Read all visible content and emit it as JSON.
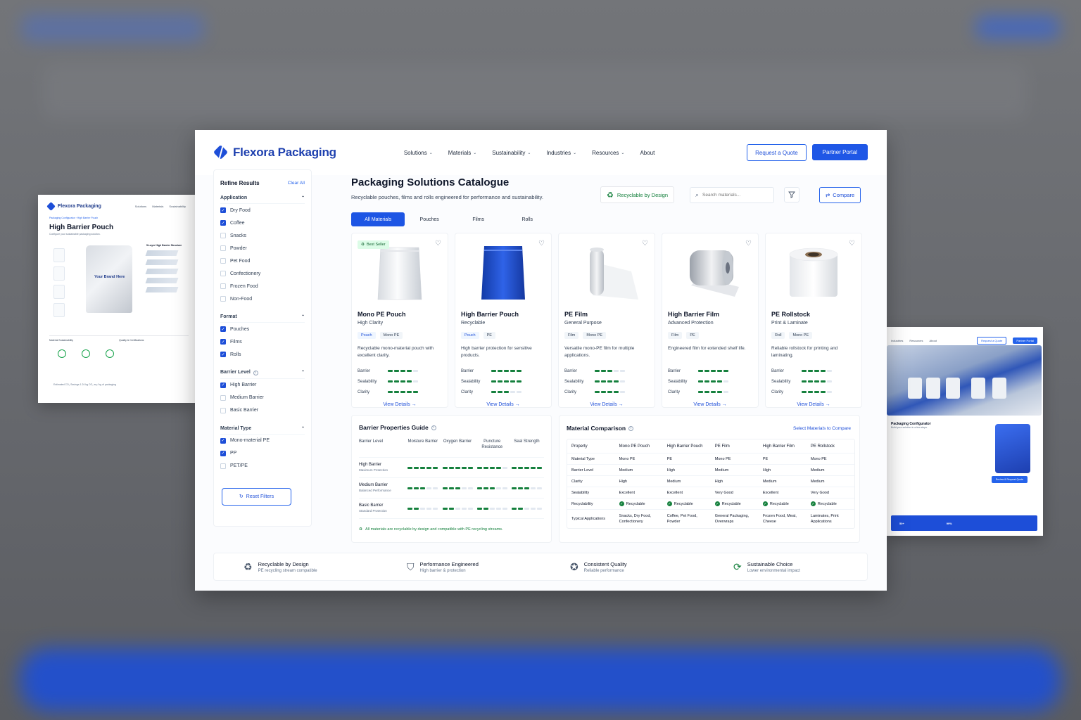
{
  "side_left": {
    "brand": "Flexora Packaging",
    "nav": [
      "Solutions",
      "Materials",
      "Sustainability"
    ],
    "breadcrumb": "Packaging Configurator  ›  High Barrier Pouch",
    "title": "High Barrier Pouch",
    "subtitle": "Configure your sustainable packaging solution.",
    "pouch_text": "Your Brand Here",
    "structure_title": "5-Layer High Barrier Structure",
    "sustainability_title": "Material Sustainability",
    "quality_title": "Quality & Certifications",
    "footer": "Estimated CO₂ Savings   1.24 kg CO₂ eq / kg of packaging"
  },
  "side_right": {
    "nav": [
      "Industries",
      "Resources",
      "About"
    ],
    "quote": "Request a Quote",
    "portal": "Partner Portal",
    "configurator_title": "Packaging Configurator",
    "configurator_sub": "Build your solution in a few steps.",
    "cta": "Review & Request Quote",
    "stat1": "50+",
    "stat2": "99%"
  },
  "nav": {
    "brand": "Flexora Packaging",
    "menu": [
      {
        "label": "Solutions",
        "dropdown": true
      },
      {
        "label": "Materials",
        "dropdown": true
      },
      {
        "label": "Sustainability",
        "dropdown": true
      },
      {
        "label": "Industries",
        "dropdown": true
      },
      {
        "label": "Resources",
        "dropdown": true
      },
      {
        "label": "About",
        "dropdown": false
      }
    ],
    "quote": "Request a Quote",
    "portal": "Partner Portal"
  },
  "sidebar": {
    "title": "Refine Results",
    "clear": "Clear All",
    "groups": [
      {
        "title": "Application",
        "info": false,
        "options": [
          {
            "label": "Dry Food",
            "checked": true
          },
          {
            "label": "Coffee",
            "checked": true
          },
          {
            "label": "Snacks",
            "checked": false
          },
          {
            "label": "Powder",
            "checked": false
          },
          {
            "label": "Pet Food",
            "checked": false
          },
          {
            "label": "Confectionery",
            "checked": false
          },
          {
            "label": "Frozen Food",
            "checked": false
          },
          {
            "label": "Non-Food",
            "checked": false
          }
        ]
      },
      {
        "title": "Format",
        "info": false,
        "options": [
          {
            "label": "Pouches",
            "checked": true
          },
          {
            "label": "Films",
            "checked": true
          },
          {
            "label": "Rolls",
            "checked": true
          }
        ]
      },
      {
        "title": "Barrier Level",
        "info": true,
        "options": [
          {
            "label": "High Barrier",
            "checked": true
          },
          {
            "label": "Medium Barrier",
            "checked": false
          },
          {
            "label": "Basic Barrier",
            "checked": false
          }
        ]
      },
      {
        "title": "Material Type",
        "info": false,
        "options": [
          {
            "label": "Mono-material PE",
            "checked": true
          },
          {
            "label": "PP",
            "checked": true
          },
          {
            "label": "PET/PE",
            "checked": false
          }
        ]
      }
    ],
    "reset": "Reset Filters"
  },
  "main": {
    "title": "Packaging Solutions Catalogue",
    "subtitle": "Recyclable pouches, films and rolls engineered for performance and sustainability.",
    "recyclable_badge": "Recyclable by Design",
    "search_placeholder": "Search materials...",
    "compare": "Compare",
    "tabs": [
      {
        "label": "All Materials",
        "active": true
      },
      {
        "label": "Pouches",
        "active": false
      },
      {
        "label": "Films",
        "active": false
      },
      {
        "label": "Rolls",
        "active": false
      }
    ]
  },
  "products": [
    {
      "title": "Mono PE Pouch",
      "subtitle": "High Clarity",
      "badge": "Best Seller",
      "image": "white-pouch",
      "tags": [
        "Pouch",
        "Mono PE"
      ],
      "desc": "Recyclable mono-material pouch with excellent clarity.",
      "barrier": 4,
      "sealability": 4,
      "clarity": 5,
      "cta": "View Details"
    },
    {
      "title": "High Barrier Pouch",
      "subtitle": "Recyclable",
      "badge": "",
      "image": "blue-pouch",
      "tags": [
        "Pouch",
        "PE"
      ],
      "desc": "High barrier protection for sensitive products.",
      "barrier": 5,
      "sealability": 5,
      "clarity": 3,
      "cta": "View Details"
    },
    {
      "title": "PE Film",
      "subtitle": "General Purpose",
      "badge": "",
      "image": "film-roll",
      "tags": [
        "Film",
        "Mono PE"
      ],
      "desc": "Versatile mono-PE film for multiple applications.",
      "barrier": 3,
      "sealability": 4,
      "clarity": 4,
      "cta": "View Details"
    },
    {
      "title": "High Barrier Film",
      "subtitle": "Advanced Protection",
      "badge": "",
      "image": "silver-roll",
      "tags": [
        "Film",
        "PE"
      ],
      "desc": "Engineered film for extended shelf life.",
      "barrier": 5,
      "sealability": 4,
      "clarity": 4,
      "cta": "View Details"
    },
    {
      "title": "PE Rollstock",
      "subtitle": "Print & Laminate",
      "badge": "",
      "image": "white-roll",
      "tags": [
        "Roll",
        "Mono PE"
      ],
      "desc": "Reliable rollstock for printing and laminating.",
      "barrier": 4,
      "sealability": 4,
      "clarity": 4,
      "cta": "View Details"
    }
  ],
  "meter_labels": [
    "Barrier",
    "Sealability",
    "Clarity"
  ],
  "guide": {
    "title": "Barrier Properties Guide",
    "columns": [
      "Barrier Level",
      "Moisture Barrier",
      "Oxygen Barrier",
      "Puncture Resistance",
      "Seal Strength"
    ],
    "rows": [
      {
        "label": "High Barrier",
        "sub": "Maximum Protection",
        "values": [
          5,
          5,
          4,
          5
        ]
      },
      {
        "label": "Medium Barrier",
        "sub": "Balanced Performance",
        "values": [
          3,
          3,
          3,
          3
        ]
      },
      {
        "label": "Basic Barrier",
        "sub": "Standard Protection",
        "values": [
          2,
          2,
          2,
          2
        ]
      }
    ],
    "note": "All materials are recyclable by design and compatible with PE recycling streams."
  },
  "comparison": {
    "title": "Material Comparison",
    "link": "Select Materials to Compare",
    "headers": [
      "Property",
      "Mono PE Pouch",
      "High Barrier Pouch",
      "PE Film",
      "High Barrier Film",
      "PE Rollstock"
    ],
    "rows": [
      [
        "Material Type",
        "Mono PE",
        "PE",
        "Mono PE",
        "PE",
        "Mono PE"
      ],
      [
        "Barrier Level",
        "Medium",
        "High",
        "Medium",
        "High",
        "Medium"
      ],
      [
        "Clarity",
        "High",
        "Medium",
        "High",
        "Medium",
        "Medium"
      ],
      [
        "Sealability",
        "Excellent",
        "Excellent",
        "Very Good",
        "Excellent",
        "Very Good"
      ],
      [
        "Recyclability",
        "Recyclable",
        "Recyclable",
        "Recyclable",
        "Recyclable",
        "Recyclable"
      ],
      [
        "Typical Applications",
        "Snacks, Dry Food, Confectionery",
        "Coffee, Pet Food, Powder",
        "General Packaging, Overwraps",
        "Frozen Food, Meat, Cheese",
        "Laminates, Print Applications"
      ]
    ]
  },
  "features": [
    {
      "icon": "recycle-icon",
      "title": "Recyclable by Design",
      "sub": "PE recycling stream compatible"
    },
    {
      "icon": "shield-icon",
      "title": "Performance Engineered",
      "sub": "High barrier & protection"
    },
    {
      "icon": "quality-icon",
      "title": "Consistent Quality",
      "sub": "Reliable performance"
    },
    {
      "icon": "leaf-cycle-icon",
      "title": "Sustainable Choice",
      "sub": "Lower environmental impact"
    }
  ],
  "colors": {
    "primary": "#1d4ed8",
    "green": "#15803d",
    "background": "#fbfcfe"
  }
}
